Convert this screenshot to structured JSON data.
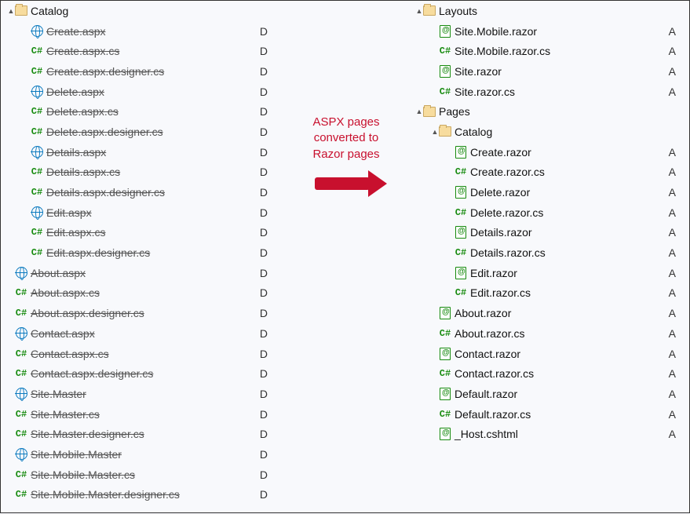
{
  "annotation": {
    "line1": "ASPX pages",
    "line2": "converted to",
    "line3": "Razor pages"
  },
  "left": [
    {
      "indent": 0,
      "toggle": "▲",
      "icon": "folder",
      "label": "Catalog",
      "status": "",
      "strike": false
    },
    {
      "indent": 1,
      "toggle": "",
      "icon": "globe",
      "label": "Create.aspx",
      "status": "D",
      "strike": true
    },
    {
      "indent": 1,
      "toggle": "",
      "icon": "csharp",
      "label": "Create.aspx.cs",
      "status": "D",
      "strike": true
    },
    {
      "indent": 1,
      "toggle": "",
      "icon": "csharp",
      "label": "Create.aspx.designer.cs",
      "status": "D",
      "strike": true
    },
    {
      "indent": 1,
      "toggle": "",
      "icon": "globe",
      "label": "Delete.aspx",
      "status": "D",
      "strike": true
    },
    {
      "indent": 1,
      "toggle": "",
      "icon": "csharp",
      "label": "Delete.aspx.cs",
      "status": "D",
      "strike": true
    },
    {
      "indent": 1,
      "toggle": "",
      "icon": "csharp",
      "label": "Delete.aspx.designer.cs",
      "status": "D",
      "strike": true
    },
    {
      "indent": 1,
      "toggle": "",
      "icon": "globe",
      "label": "Details.aspx",
      "status": "D",
      "strike": true
    },
    {
      "indent": 1,
      "toggle": "",
      "icon": "csharp",
      "label": "Details.aspx.cs",
      "status": "D",
      "strike": true
    },
    {
      "indent": 1,
      "toggle": "",
      "icon": "csharp",
      "label": "Details.aspx.designer.cs",
      "status": "D",
      "strike": true
    },
    {
      "indent": 1,
      "toggle": "",
      "icon": "globe",
      "label": "Edit.aspx",
      "status": "D",
      "strike": true
    },
    {
      "indent": 1,
      "toggle": "",
      "icon": "csharp",
      "label": "Edit.aspx.cs",
      "status": "D",
      "strike": true
    },
    {
      "indent": 1,
      "toggle": "",
      "icon": "csharp",
      "label": "Edit.aspx.designer.cs",
      "status": "D",
      "strike": true
    },
    {
      "indent": 0,
      "toggle": "",
      "icon": "globe",
      "label": "About.aspx",
      "status": "D",
      "strike": true
    },
    {
      "indent": 0,
      "toggle": "",
      "icon": "csharp",
      "label": "About.aspx.cs",
      "status": "D",
      "strike": true
    },
    {
      "indent": 0,
      "toggle": "",
      "icon": "csharp",
      "label": "About.aspx.designer.cs",
      "status": "D",
      "strike": true
    },
    {
      "indent": 0,
      "toggle": "",
      "icon": "globe",
      "label": "Contact.aspx",
      "status": "D",
      "strike": true
    },
    {
      "indent": 0,
      "toggle": "",
      "icon": "csharp",
      "label": "Contact.aspx.cs",
      "status": "D",
      "strike": true
    },
    {
      "indent": 0,
      "toggle": "",
      "icon": "csharp",
      "label": "Contact.aspx.designer.cs",
      "status": "D",
      "strike": true
    },
    {
      "indent": 0,
      "toggle": "",
      "icon": "globe",
      "label": "Site.Master",
      "status": "D",
      "strike": true
    },
    {
      "indent": 0,
      "toggle": "",
      "icon": "csharp",
      "label": "Site.Master.cs",
      "status": "D",
      "strike": true
    },
    {
      "indent": 0,
      "toggle": "",
      "icon": "csharp",
      "label": "Site.Master.designer.cs",
      "status": "D",
      "strike": true
    },
    {
      "indent": 0,
      "toggle": "",
      "icon": "globe",
      "label": "Site.Mobile.Master",
      "status": "D",
      "strike": true
    },
    {
      "indent": 0,
      "toggle": "",
      "icon": "csharp",
      "label": "Site.Mobile.Master.cs",
      "status": "D",
      "strike": true
    },
    {
      "indent": 0,
      "toggle": "",
      "icon": "csharp",
      "label": "Site.Mobile.Master.designer.cs",
      "status": "D",
      "strike": true
    }
  ],
  "right": [
    {
      "indent": 0,
      "toggle": "▲",
      "icon": "folder",
      "label": "Layouts",
      "status": "",
      "strike": false
    },
    {
      "indent": 1,
      "toggle": "",
      "icon": "razor",
      "label": "Site.Mobile.razor",
      "status": "A",
      "strike": false
    },
    {
      "indent": 1,
      "toggle": "",
      "icon": "csharp",
      "label": "Site.Mobile.razor.cs",
      "status": "A",
      "strike": false
    },
    {
      "indent": 1,
      "toggle": "",
      "icon": "razor",
      "label": "Site.razor",
      "status": "A",
      "strike": false
    },
    {
      "indent": 1,
      "toggle": "",
      "icon": "csharp",
      "label": "Site.razor.cs",
      "status": "A",
      "strike": false
    },
    {
      "indent": 0,
      "toggle": "▲",
      "icon": "folder",
      "label": "Pages",
      "status": "",
      "strike": false
    },
    {
      "indent": 1,
      "toggle": "▲",
      "icon": "folder",
      "label": "Catalog",
      "status": "",
      "strike": false
    },
    {
      "indent": 2,
      "toggle": "",
      "icon": "razor",
      "label": "Create.razor",
      "status": "A",
      "strike": false
    },
    {
      "indent": 2,
      "toggle": "",
      "icon": "csharp",
      "label": "Create.razor.cs",
      "status": "A",
      "strike": false
    },
    {
      "indent": 2,
      "toggle": "",
      "icon": "razor",
      "label": "Delete.razor",
      "status": "A",
      "strike": false
    },
    {
      "indent": 2,
      "toggle": "",
      "icon": "csharp",
      "label": "Delete.razor.cs",
      "status": "A",
      "strike": false
    },
    {
      "indent": 2,
      "toggle": "",
      "icon": "razor",
      "label": "Details.razor",
      "status": "A",
      "strike": false
    },
    {
      "indent": 2,
      "toggle": "",
      "icon": "csharp",
      "label": "Details.razor.cs",
      "status": "A",
      "strike": false
    },
    {
      "indent": 2,
      "toggle": "",
      "icon": "razor",
      "label": "Edit.razor",
      "status": "A",
      "strike": false
    },
    {
      "indent": 2,
      "toggle": "",
      "icon": "csharp",
      "label": "Edit.razor.cs",
      "status": "A",
      "strike": false
    },
    {
      "indent": 1,
      "toggle": "",
      "icon": "razor",
      "label": "About.razor",
      "status": "A",
      "strike": false
    },
    {
      "indent": 1,
      "toggle": "",
      "icon": "csharp",
      "label": "About.razor.cs",
      "status": "A",
      "strike": false
    },
    {
      "indent": 1,
      "toggle": "",
      "icon": "razor",
      "label": "Contact.razor",
      "status": "A",
      "strike": false
    },
    {
      "indent": 1,
      "toggle": "",
      "icon": "csharp",
      "label": "Contact.razor.cs",
      "status": "A",
      "strike": false
    },
    {
      "indent": 1,
      "toggle": "",
      "icon": "razor",
      "label": "Default.razor",
      "status": "A",
      "strike": false
    },
    {
      "indent": 1,
      "toggle": "",
      "icon": "csharp",
      "label": "Default.razor.cs",
      "status": "A",
      "strike": false
    },
    {
      "indent": 1,
      "toggle": "",
      "icon": "razor",
      "label": "_Host.cshtml",
      "status": "A",
      "strike": false
    }
  ]
}
